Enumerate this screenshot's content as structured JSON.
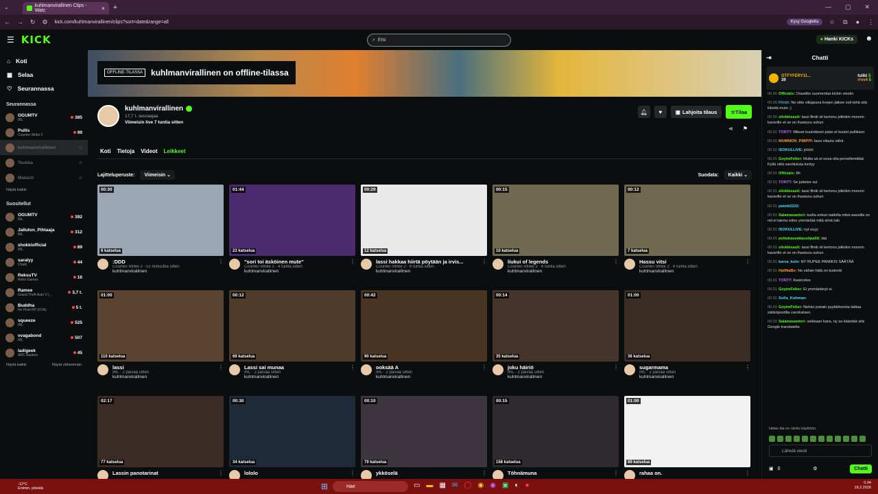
{
  "browser": {
    "tab_title": "kuhlmanvirallinen Clips - Watc",
    "url": "kick.com/kuhlmanvirallinen/clips?sort=date&range=all",
    "ask_google": "Kysy Googlelta"
  },
  "header": {
    "logo": "KICK",
    "search_placeholder": "Etsi",
    "get_kicks": "Hanki KICKs"
  },
  "sidebar": {
    "nav": [
      {
        "label": "Koti",
        "icon": "home-icon"
      },
      {
        "label": "Selaa",
        "icon": "browse-icon"
      },
      {
        "label": "Seurannassa",
        "icon": "heart-icon"
      }
    ],
    "following_title": "Seurannassa",
    "following": [
      {
        "name": "OGUMTV",
        "game": "IRL",
        "viewers": "385"
      },
      {
        "name": "Pullis",
        "game": "Counter-Strike 2",
        "viewers": "99"
      },
      {
        "name": "kuhlmanvirallinen",
        "game": "",
        "viewers": ""
      },
      {
        "name": "Teukka",
        "game": "",
        "viewers": ""
      },
      {
        "name": "Makezii",
        "game": "",
        "viewers": ""
      }
    ],
    "show_all_following": "Näytä kaikki",
    "recommended_title": "Suositellut",
    "recommended": [
      {
        "name": "OGUMTV",
        "game": "IRL",
        "viewers": "392"
      },
      {
        "name": "Jalluton_Pihtaaja",
        "game": "IRL",
        "viewers": "312"
      },
      {
        "name": "shokkiofficial",
        "game": "IRL",
        "viewers": "89"
      },
      {
        "name": "saralyy",
        "game": "Chatti",
        "viewers": "44"
      },
      {
        "name": "ReksuTV",
        "game": "Retro Games",
        "viewers": "16"
      },
      {
        "name": "Ramee",
        "game": "Grand Theft Auto V (...",
        "viewers": "3,7 t."
      },
      {
        "name": "Buddha",
        "game": "No Pixel RP (GTA)",
        "viewers": "5 t."
      },
      {
        "name": "squeeze",
        "game": "IRL",
        "viewers": "525"
      },
      {
        "name": "vvagabond",
        "game": "IRL",
        "viewers": "507"
      },
      {
        "name": "ladigeek",
        "game": "ARC Raiders",
        "viewers": "45"
      }
    ],
    "show_all": "Näytä kaikki",
    "show_less": "Näytä vähemmän"
  },
  "channel": {
    "offline_tag": "OFFLINE-TILASSA",
    "offline_text": "kuhlmanvirallinen on offline-tilassa",
    "name": "kuhlmanvirallinen",
    "followers": "17,7 t. seuraajaa",
    "last_live": "Viimeisin live 7 tuntia sitten",
    "gift_sub": "Lahjoita tilaus",
    "subscribe": "Tilaa",
    "tabs": [
      "Koti",
      "Tietoja",
      "Videot",
      "Leikkeet"
    ],
    "active_tab": "Leikkeet",
    "sort_label": "Lajitteluperuste:",
    "sort_value": "Viimeisin",
    "filter_label": "Suodata:",
    "filter_value": "Kaikki"
  },
  "clips": [
    {
      "dur": "00:30",
      "views": "6 katselua",
      "title": ":DDD",
      "meta": "Counter-Strike 2 · 51 minuuttia sitten",
      "channel": "kuhlmanvirallinen",
      "bg": "#9aa6b3"
    },
    {
      "dur": "01:44",
      "views": "23 katselua",
      "title": "\"sori toi äsköinen mute\"",
      "meta": "Counter-Strike 2 · 4 tuntia sitten",
      "channel": "kuhlmanvirallinen",
      "bg": "#4b2a6e"
    },
    {
      "dur": "00:29",
      "views": "12 katselua",
      "title": "lassi hakkaa hiirtä pöytään ja irvis...",
      "meta": "Counter-Strike 2 · 6 tuntia sitten",
      "channel": "kuhlmanvirallinen",
      "bg": "#e9e9e9"
    },
    {
      "dur": "00:15",
      "views": "10 katselua",
      "title": "liukui of legends",
      "meta": "Counter-Strike 2 · 6 tuntia sitten",
      "channel": "kuhlmanvirallinen",
      "bg": "#6f6a4f"
    },
    {
      "dur": "00:12",
      "views": "7 katselua",
      "title": "Hassu vitsi",
      "meta": "Counter-Strike 2 · 6 tuntia sitten",
      "channel": "kuhlmanvirallinen",
      "bg": "#6f6a4f"
    },
    {
      "dur": "01:00",
      "views": "110 katselua",
      "title": "lassi",
      "meta": "IRL · 2 päivää sitten",
      "channel": "kuhlmanvirallinen",
      "bg": "#5a4330"
    },
    {
      "dur": "00:12",
      "views": "69 katselua",
      "title": "Lassi sai munaa",
      "meta": "IRL · 2 päivää sitten",
      "channel": "kuhlmanvirallinen",
      "bg": "#4f3b2a"
    },
    {
      "dur": "00:42",
      "views": "90 katselua",
      "title": "ooksää A",
      "meta": "IRL · 2 päivää sitten",
      "channel": "kuhlmanvirallinen",
      "bg": "#4a3525"
    },
    {
      "dur": "00:14",
      "views": "35 katselua",
      "title": "joku häiriö",
      "meta": "IRL · 2 päivää sitten",
      "channel": "kuhlmanvirallinen",
      "bg": "#46342a"
    },
    {
      "dur": "01:00",
      "views": "36 katselua",
      "title": "sugarmama",
      "meta": "IRL · 2 päivää sitten",
      "channel": "kuhlmanvirallinen",
      "bg": "#3b2d24"
    },
    {
      "dur": "02:17",
      "views": "77 katselua",
      "title": "Lassin panotarinat",
      "meta": "",
      "channel": "",
      "bg": "#3a2b24"
    },
    {
      "dur": "00:30",
      "views": "34 katselua",
      "title": "lololo",
      "meta": "",
      "channel": "",
      "bg": "#1e2a3a"
    },
    {
      "dur": "00:10",
      "views": "79 katselua",
      "title": "ykköselä",
      "meta": "",
      "channel": "",
      "bg": "#3d3540"
    },
    {
      "dur": "00:15",
      "views": "158 katselua",
      "title": "Töhnämuna",
      "meta": "",
      "channel": "",
      "bg": "#2e2a2e"
    },
    {
      "dur": "01:00",
      "views": "69 katselua",
      "title": "rahaa on.",
      "meta": "",
      "channel": "",
      "bg": "#f2f2f2"
    }
  ],
  "chat": {
    "title": "Chatti",
    "pinned_user": "GTFYFERY11...",
    "pinned_count": "39",
    "pinned_user2": "tuliki",
    "pinned_user2_val": "5",
    "pinned_user3": "rrvv4",
    "pinned_user3_val": "5",
    "messages": [
      {
        "t": "00.00",
        "u": "Officials:",
        "c": "#53fc18",
        "m": "Osasitko suomentaa kickin viestin"
      },
      {
        "t": "00.00",
        "u": "Flintii:",
        "c": "#4ad",
        "m": "No sitte viikppuna livejen jäikee voit tehä sitä liikettä mute ;)"
      },
      {
        "t": "00.00",
        "u": "sliokkisauli:",
        "c": "#53fc18",
        "m": "lassi flintii oli kertonu jolleikin monnin kaverille et se on ihastunu suhun"
      },
      {
        "t": "00.01",
        "u": "TONTT:",
        "c": "#b6f",
        "m": "Mikset kuulokkeet pääs et kuulet pulliksen"
      },
      {
        "t": "00.01",
        "u": "MUMMON_PIMPPI:",
        "c": "#f93",
        "m": "lassi vilauta vähä"
      },
      {
        "t": "00.01",
        "u": "ISOKULLIVE:",
        "c": "#4df",
        "m": "jöööö"
      },
      {
        "t": "00.01",
        "u": "GoyimFelter:",
        "c": "#53fc18",
        "m": "Mutta sä et oosa olla persellemittää Kyllä niitä varoituksia kertyy"
      },
      {
        "t": "00.01",
        "u": "Officials:",
        "c": "#53fc18",
        "m": "8h"
      },
      {
        "t": "00.01",
        "u": "TONTT:",
        "c": "#b6f",
        "m": "Se juttelee sul"
      },
      {
        "t": "00.01",
        "u": "sliokkisauli:",
        "c": "#53fc18",
        "m": "lassi flintii oli kertonu jolleikin monnin kaverille et se on ihastunu suhun"
      },
      {
        "t": "00.01",
        "u": "paletti2222:",
        "c": "#4df",
        "m": ""
      },
      {
        "t": "00.01",
        "u": "Salamasanteri:",
        "c": "#53fc18",
        "m": "tuolla enkun taidolla mikä wassilla on niil ei tainnu edes ymmärtää mitä siinä luki"
      },
      {
        "t": "00.01",
        "u": "ISOKULLIVE:",
        "c": "#4df",
        "m": "nyt uuyy"
      },
      {
        "t": "00.01",
        "u": "pottukasvattauslipallit:",
        "c": "#53fc18",
        "m": "tää"
      },
      {
        "t": "00.01",
        "u": "sliokkisauli:",
        "c": "#53fc18",
        "m": "lassi flintii oli kertonu jolleikin monnin kaverille et se on ihastunu suhun"
      },
      {
        "t": "00.01",
        "u": "karva_kolo:",
        "c": "#4df",
        "m": "NY RUPEE PANIIKIS SÄÄTÄÄ"
      },
      {
        "t": "00.01",
        "u": "HallNaBe:",
        "c": "#f93",
        "m": "No vähän hälä on kuitenki"
      },
      {
        "t": "00.01",
        "u": "TONTT:",
        "c": "#b6f",
        "m": "Kasinolive"
      },
      {
        "t": "00.01",
        "u": "GoyimFelter:",
        "c": "#53fc18",
        "m": "Ei ymmärtänyt ei"
      },
      {
        "t": "00.01",
        "u": "Sofia_Kuhman:",
        "c": "#4df",
        "m": ""
      },
      {
        "t": "00.01",
        "u": "GoyimFelter:",
        "c": "#53fc18",
        "m": "Nehän jostain pyykkikorista laittaa sähköpostilla varoituksen"
      },
      {
        "t": "00.02",
        "u": "Salamasanteri:",
        "c": "#53fc18",
        "m": "veikkaan kans, ny se kääntää sitä Google translatella"
      }
    ],
    "slow_mode": "Hidas tila on otettu käyttöön.",
    "input_placeholder": "Lähetä viesti",
    "kicks_count": "0",
    "send_label": "Chatti"
  },
  "taskbar": {
    "temp": "-12°C",
    "weather": "Enimm. pilvistä",
    "search": "Hae",
    "time": "0.04",
    "date": "18.2.2026"
  }
}
